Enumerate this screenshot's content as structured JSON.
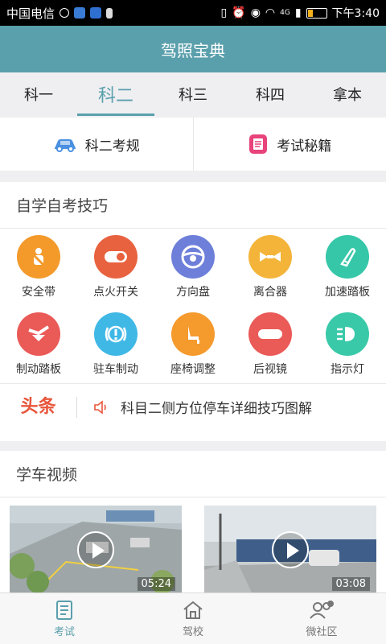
{
  "status_bar": {
    "carrier": "中国电信",
    "time": "下午3:40",
    "network": "4G",
    "battery_color": "#f2b01e"
  },
  "app": {
    "title": "驾照宝典",
    "accent": "#5a9fac"
  },
  "tabs": [
    {
      "label": "科一",
      "active": false
    },
    {
      "label": "科二",
      "active": true
    },
    {
      "label": "科三",
      "active": false
    },
    {
      "label": "科四",
      "active": false
    },
    {
      "label": "拿本",
      "active": false
    }
  ],
  "quick_links": [
    {
      "label": "科二考规",
      "icon": "car-icon",
      "color": "#4a90e2"
    },
    {
      "label": "考试秘籍",
      "icon": "document-icon",
      "color": "#e8437a"
    }
  ],
  "skills": {
    "title": "自学自考技巧",
    "items": [
      {
        "label": "安全带",
        "icon": "seatbelt-icon",
        "color": "#f39a2b"
      },
      {
        "label": "点火开关",
        "icon": "ignition-switch-icon",
        "color": "#e8623f"
      },
      {
        "label": "方向盘",
        "icon": "steering-wheel-icon",
        "color": "#6d7fd9"
      },
      {
        "label": "离合器",
        "icon": "clutch-icon",
        "color": "#f4b43a"
      },
      {
        "label": "加速踏板",
        "icon": "accelerator-pedal-icon",
        "color": "#35c7a8"
      },
      {
        "label": "制动踏板",
        "icon": "brake-pedal-icon",
        "color": "#ea5a57"
      },
      {
        "label": "驻车制动",
        "icon": "parking-brake-icon",
        "color": "#3fb8e6"
      },
      {
        "label": "座椅调整",
        "icon": "seat-adjust-icon",
        "color": "#f59a2d"
      },
      {
        "label": "后视镜",
        "icon": "rearview-mirror-icon",
        "color": "#ea5a57"
      },
      {
        "label": "指示灯",
        "icon": "indicator-light-icon",
        "color": "#39c9a8"
      }
    ]
  },
  "headline": {
    "tag": "头条",
    "text": "科目二侧方位停车详细技巧图解",
    "icon": "speaker-icon"
  },
  "videos": {
    "title": "学车视频",
    "items": [
      {
        "duration": "05:24"
      },
      {
        "duration": "03:08"
      }
    ]
  },
  "bottom_nav": [
    {
      "label": "考试",
      "icon": "exam-icon",
      "active": true
    },
    {
      "label": "驾校",
      "icon": "home-icon",
      "active": false
    },
    {
      "label": "微社区",
      "icon": "community-icon",
      "active": false
    }
  ]
}
